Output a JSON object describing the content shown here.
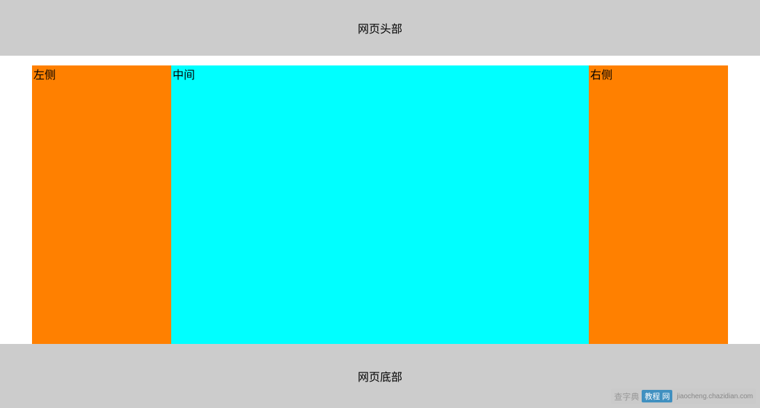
{
  "header": {
    "title": "网页头部"
  },
  "layout": {
    "left_label": "左侧",
    "middle_label": "中间",
    "right_label": "右侧"
  },
  "footer": {
    "title": "网页底部"
  },
  "watermark": {
    "text": "查字典",
    "badge": "教程 网",
    "url": "jiaocheng.chazidian.com"
  },
  "colors": {
    "header_bg": "#cccccc",
    "footer_bg": "#cccccc",
    "side_bg": "#ff8000",
    "middle_bg": "#00ffff"
  }
}
